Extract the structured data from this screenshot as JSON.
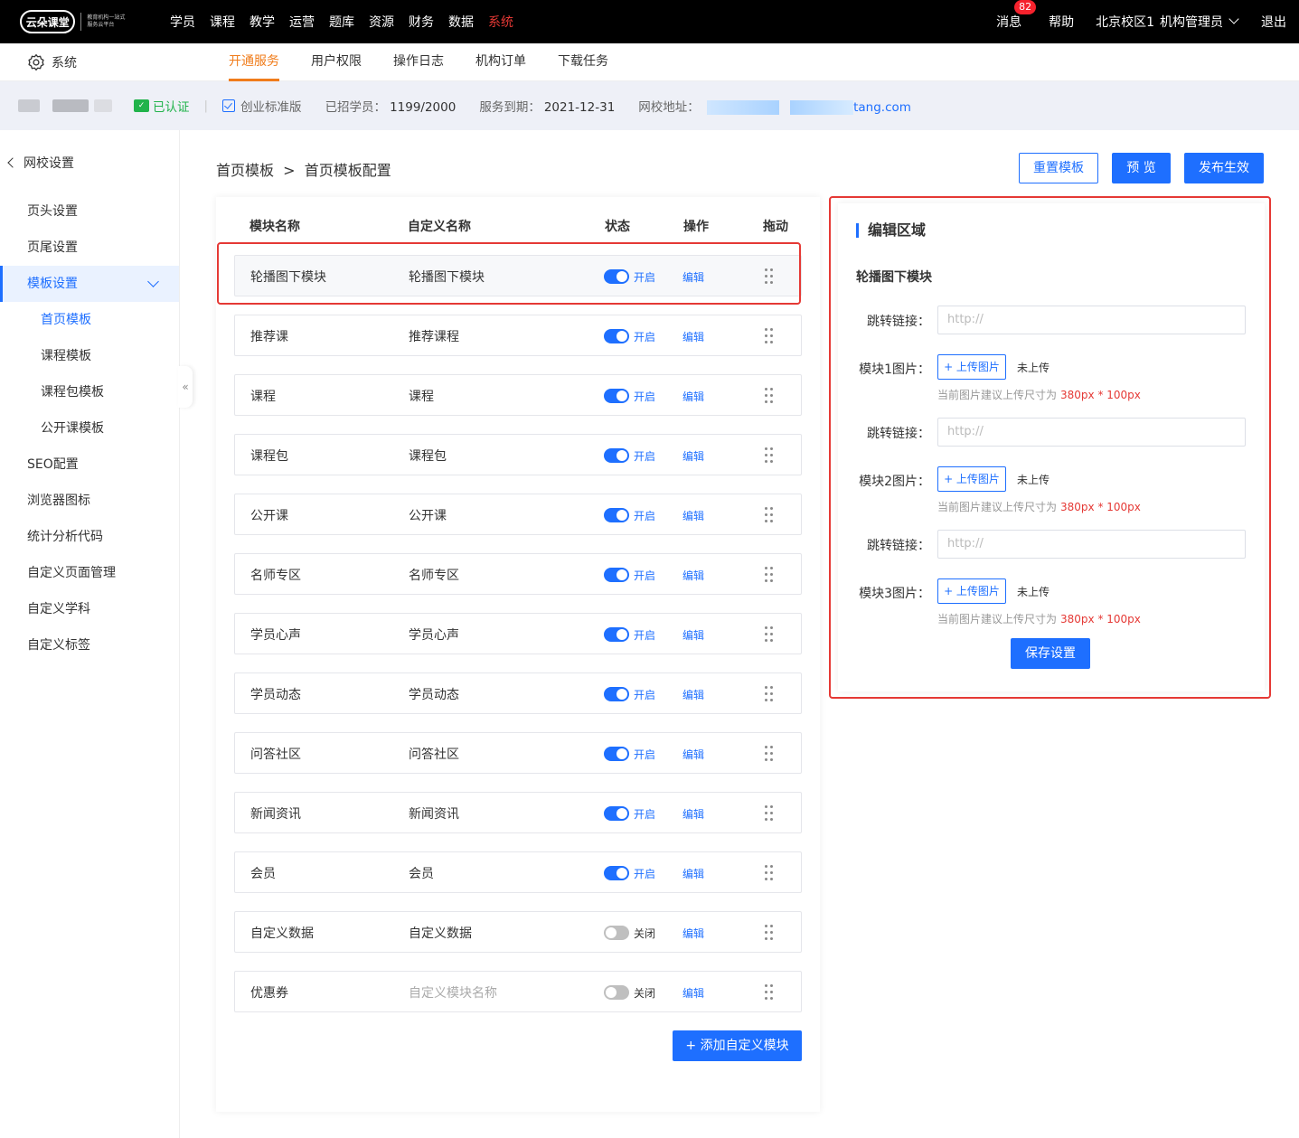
{
  "header": {
    "logo_text": "云朵课堂",
    "logo_sub": "教育机构一站式服务云平台",
    "nav": [
      "学员",
      "课程",
      "教学",
      "运营",
      "题库",
      "资源",
      "财务",
      "数据",
      "系统"
    ],
    "active_nav_index": 8,
    "messages_label": "消息",
    "messages_count": "82",
    "help_label": "帮助",
    "campus": "北京校区1",
    "role": "机构管理员",
    "logout_label": "退出"
  },
  "subnav": {
    "section_label": "系统",
    "tabs": [
      "开通服务",
      "用户权限",
      "操作日志",
      "机构订单",
      "下载任务"
    ],
    "active_tab_index": 0
  },
  "info": {
    "certified_label": "已认证",
    "edition_label": "创业标准版",
    "students_label": "已招学员：",
    "students_value": "1199/2000",
    "expire_label": "服务到期：",
    "expire_value": "2021-12-31",
    "url_label": "网校地址：",
    "url_tail": "tang.com"
  },
  "sidebar": {
    "back_label": "网校设置",
    "items": [
      {
        "label": "页头设置",
        "level": 1
      },
      {
        "label": "页尾设置",
        "level": 1
      },
      {
        "label": "模板设置",
        "level": 1,
        "active": true
      },
      {
        "label": "首页模板",
        "level": 2,
        "active": true
      },
      {
        "label": "课程模板",
        "level": 2
      },
      {
        "label": "课程包模板",
        "level": 2
      },
      {
        "label": "公开课模板",
        "level": 2
      },
      {
        "label": "SEO配置",
        "level": 1
      },
      {
        "label": "浏览器图标",
        "level": 1
      },
      {
        "label": "统计分析代码",
        "level": 1
      },
      {
        "label": "自定义页面管理",
        "level": 1
      },
      {
        "label": "自定义学科",
        "level": 1
      },
      {
        "label": "自定义标签",
        "level": 1
      }
    ]
  },
  "main": {
    "breadcrumb": "首页模板  >  首页模板配置",
    "buttons": {
      "reset": "重置模板",
      "preview": "预 览",
      "publish": "发布生效"
    },
    "columns": {
      "name": "模块名称",
      "alias": "自定义名称",
      "status": "状态",
      "action": "操作",
      "drag": "拖动"
    },
    "edit_label": "编辑",
    "on_label": "开启",
    "off_label": "关闭",
    "rows": [
      {
        "name": "轮播图下模块",
        "alias": "轮播图下模块",
        "on": true
      },
      {
        "name": "推荐课",
        "alias": "推荐课程",
        "on": true
      },
      {
        "name": "课程",
        "alias": "课程",
        "on": true
      },
      {
        "name": "课程包",
        "alias": "课程包",
        "on": true
      },
      {
        "name": "公开课",
        "alias": "公开课",
        "on": true
      },
      {
        "name": "名师专区",
        "alias": "名师专区",
        "on": true
      },
      {
        "name": "学员心声",
        "alias": "学员心声",
        "on": true
      },
      {
        "name": "学员动态",
        "alias": "学员动态",
        "on": true
      },
      {
        "name": "问答社区",
        "alias": "问答社区",
        "on": true
      },
      {
        "name": "新闻资讯",
        "alias": "新闻资讯",
        "on": true
      },
      {
        "name": "会员",
        "alias": "会员",
        "on": true
      },
      {
        "name": "自定义数据",
        "alias": "自定义数据",
        "on": false
      },
      {
        "name": "优惠券",
        "alias": "",
        "alias_placeholder": "自定义模块名称",
        "on": false
      }
    ],
    "add_button": "+ 添加自定义模块"
  },
  "editor": {
    "title": "编辑区域",
    "subtitle": "轮播图下模块",
    "link_label": "跳转链接：",
    "link_placeholder": "http://",
    "upload_button": "+ 上传图片",
    "not_uploaded": "未上传",
    "tip_prefix": "当前图片建议上传尺寸为",
    "tip_size": "380px * 100px",
    "blocks": [
      {
        "image_label": "模块1图片："
      },
      {
        "image_label": "模块2图片："
      },
      {
        "image_label": "模块3图片："
      }
    ],
    "save_button": "保存设置"
  },
  "colors": {
    "primary": "#1e6fff",
    "highlight": "#e53935",
    "accent_tab": "#f07c1b",
    "certified": "#21b34b"
  }
}
